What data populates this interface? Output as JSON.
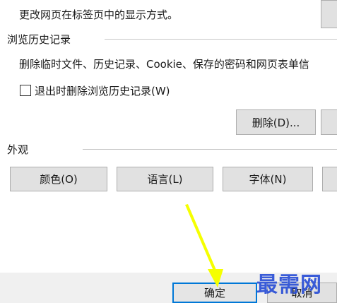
{
  "tabs_description": "更改网页在标签页中的显示方式。",
  "history": {
    "title": "浏览历史记录",
    "description": "删除临时文件、历史记录、Cookie、保存的密码和网页表单信",
    "checkbox_label": "退出时删除浏览历史记录(W)",
    "checkbox_checked": false,
    "delete_button": "删除(D)..."
  },
  "appearance": {
    "title": "外观",
    "buttons": [
      "颜色(O)",
      "语言(L)",
      "字体(N)"
    ]
  },
  "footer": {
    "ok_button": "确定",
    "cancel_button": "取消"
  },
  "watermark": "最需网",
  "colors": {
    "accent": "#0078d7",
    "arrow": "#f5ff00",
    "watermark": "#2a4fd6"
  }
}
